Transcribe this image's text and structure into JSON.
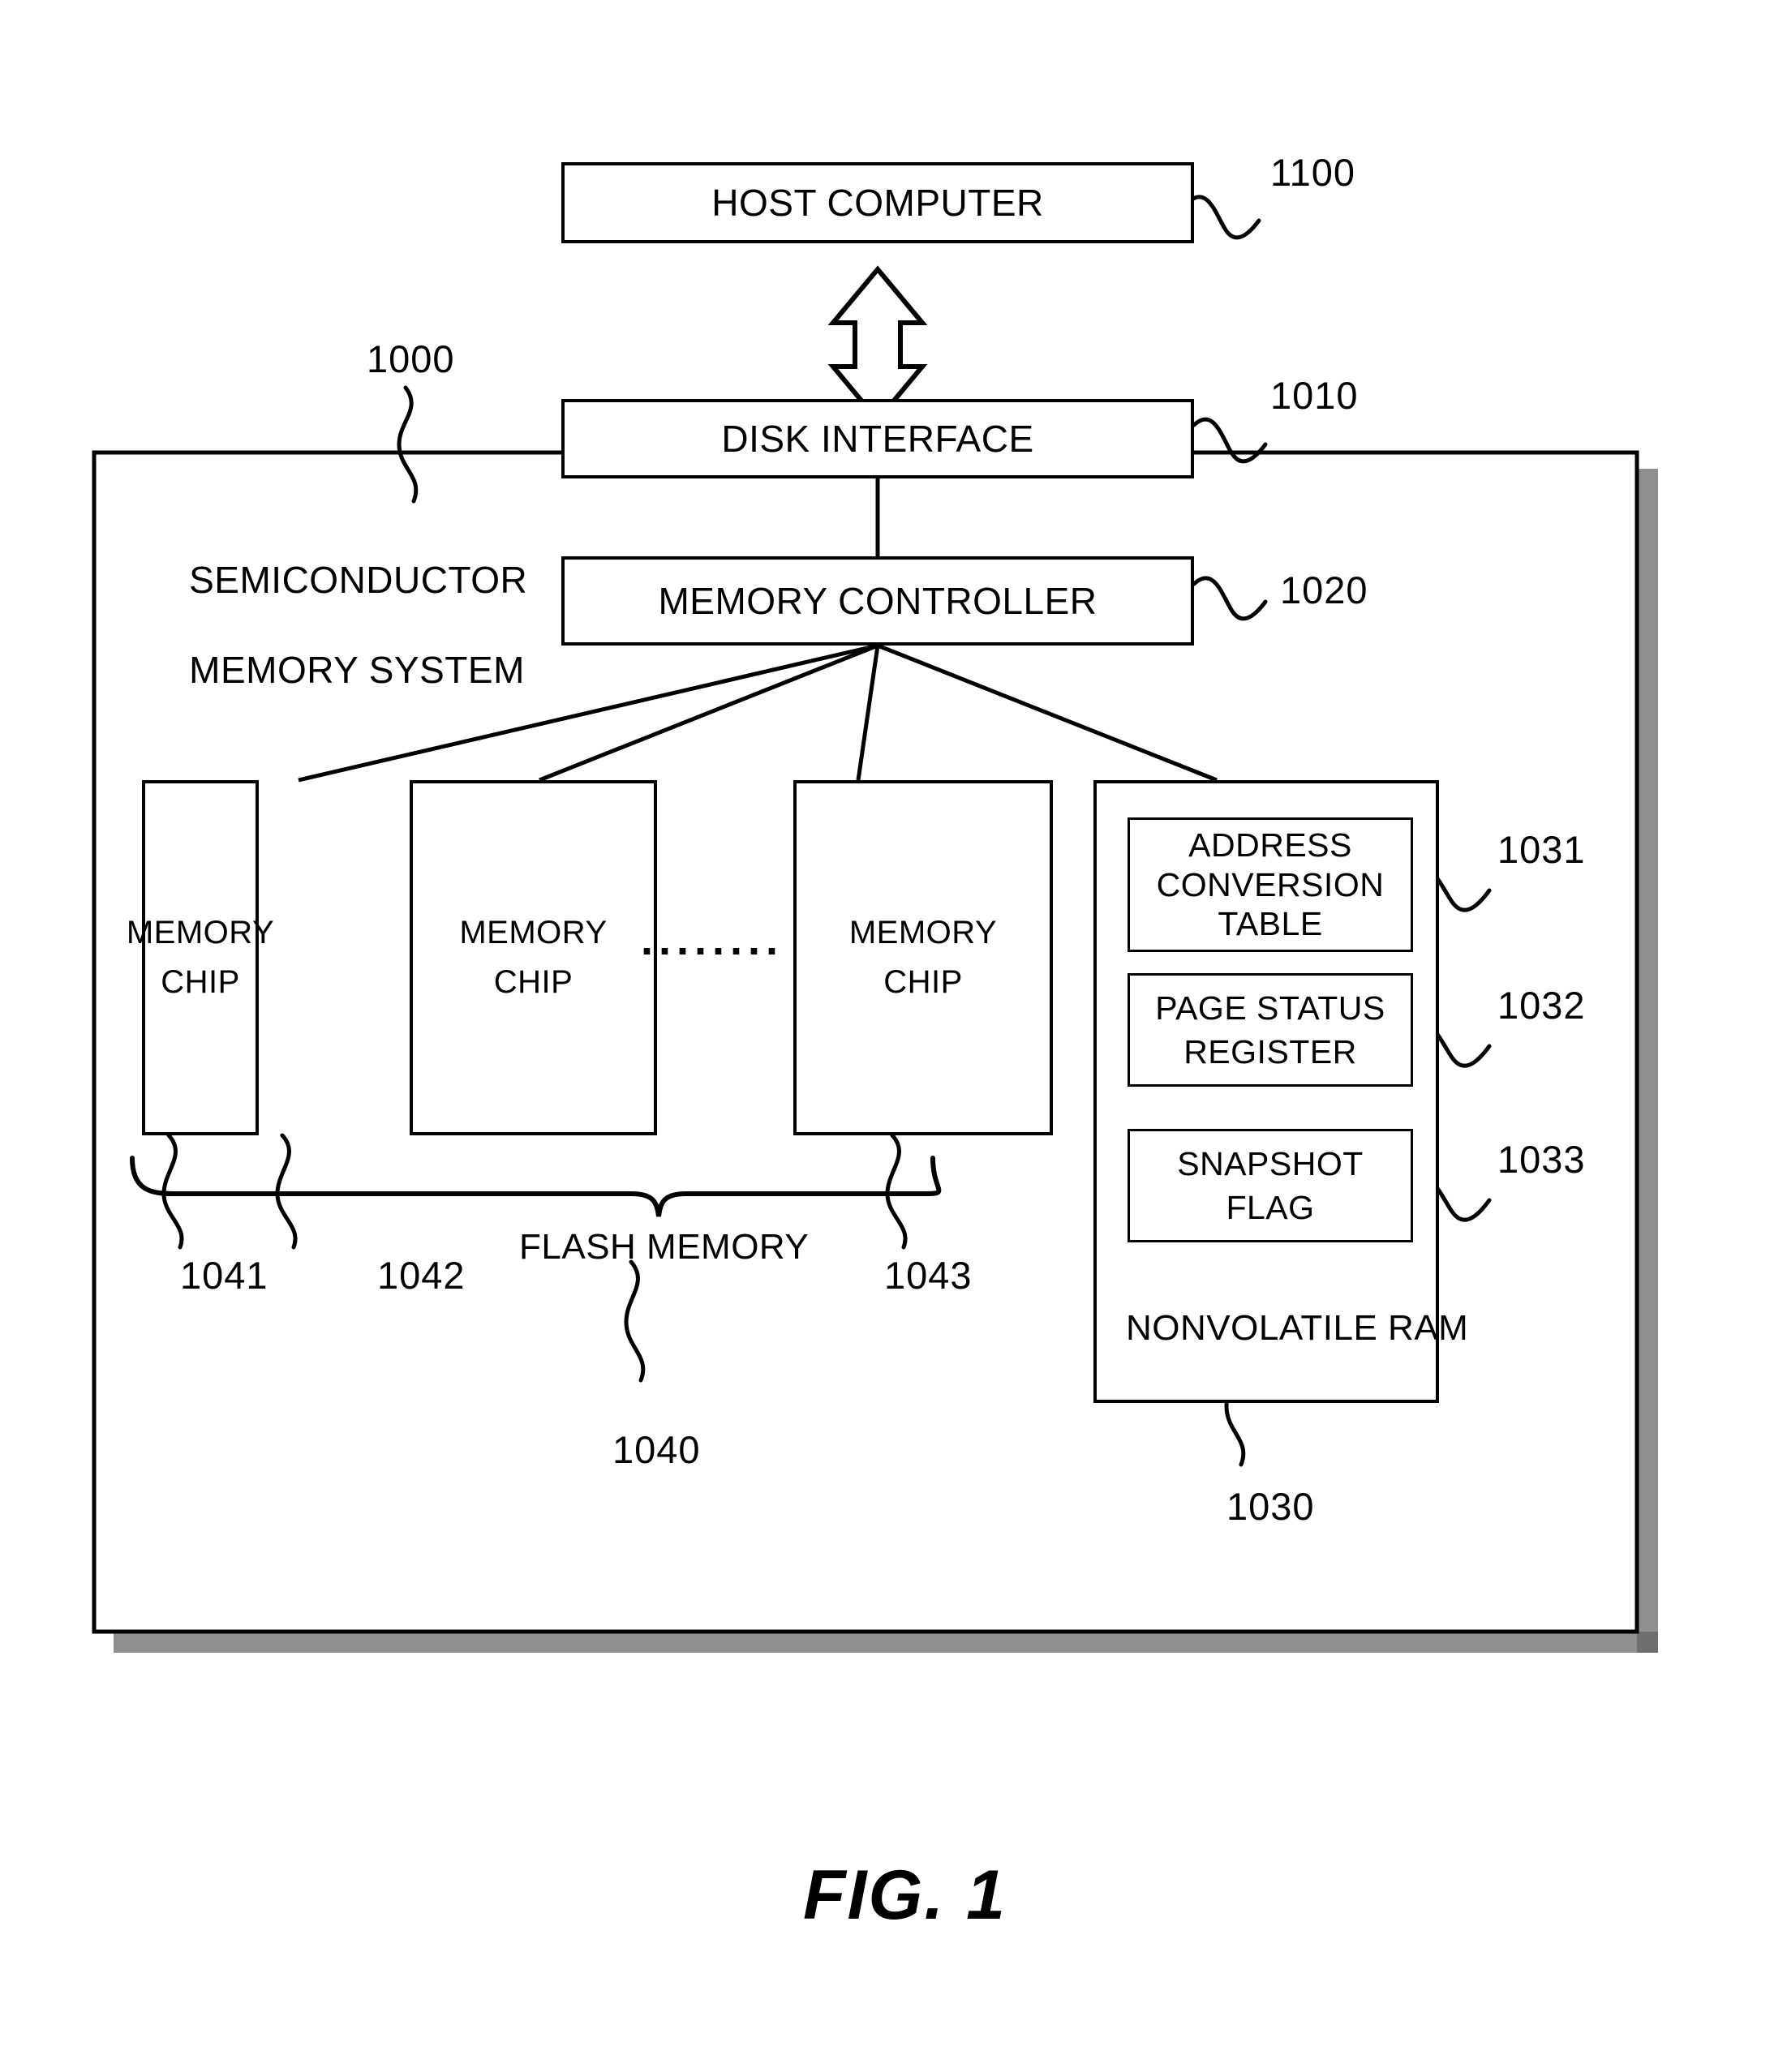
{
  "figure": {
    "caption": "FIG. 1",
    "system_label_line1": "SEMICONDUCTOR",
    "system_label_line2": "MEMORY SYSTEM"
  },
  "blocks": {
    "host_computer": {
      "label": "HOST COMPUTER",
      "ref": "1100"
    },
    "disk_interface": {
      "label": "DISK INTERFACE",
      "ref": "1010"
    },
    "memory_controller": {
      "label": "MEMORY CONTROLLER",
      "ref": "1020"
    },
    "semiconductor_memory_system": {
      "ref": "1000"
    },
    "memory_chip_1": {
      "label_line1": "MEMORY",
      "label_line2": "CHIP",
      "ref": "1041"
    },
    "memory_chip_2": {
      "label_line1": "MEMORY",
      "label_line2": "CHIP",
      "ref": "1042"
    },
    "memory_chip_3": {
      "label_line1": "MEMORY",
      "label_line2": "CHIP",
      "ref": "1043"
    },
    "memory_chip_ellipsis": "........",
    "flash_memory": {
      "label": "FLASH MEMORY",
      "ref": "1040"
    },
    "nonvolatile_ram": {
      "label": "NONVOLATILE RAM",
      "ref": "1030"
    },
    "address_conversion_table": {
      "label_line1": "ADDRESS",
      "label_line2": "CONVERSION",
      "label_line3": "TABLE",
      "ref": "1031"
    },
    "page_status_register": {
      "label_line1": "PAGE STATUS",
      "label_line2": "REGISTER",
      "ref": "1032"
    },
    "snapshot_flag": {
      "label_line1": "SNAPSHOT",
      "label_line2": "FLAG",
      "ref": "1033"
    }
  },
  "colors": {
    "ink": "#000000",
    "paper": "#ffffff",
    "shadow": "#9a9a9a"
  },
  "chart_data": {
    "type": "diagram",
    "title": "FIG. 1",
    "nodes": [
      {
        "id": "1100",
        "name": "HOST COMPUTER"
      },
      {
        "id": "1000",
        "name": "SEMICONDUCTOR MEMORY SYSTEM"
      },
      {
        "id": "1010",
        "name": "DISK INTERFACE"
      },
      {
        "id": "1020",
        "name": "MEMORY CONTROLLER"
      },
      {
        "id": "1040",
        "name": "FLASH MEMORY"
      },
      {
        "id": "1041",
        "name": "MEMORY CHIP"
      },
      {
        "id": "1042",
        "name": "MEMORY CHIP"
      },
      {
        "id": "1043",
        "name": "MEMORY CHIP"
      },
      {
        "id": "1030",
        "name": "NONVOLATILE RAM"
      },
      {
        "id": "1031",
        "name": "ADDRESS CONVERSION TABLE"
      },
      {
        "id": "1032",
        "name": "PAGE STATUS REGISTER"
      },
      {
        "id": "1033",
        "name": "SNAPSHOT FLAG"
      }
    ],
    "edges": [
      {
        "from": "1100",
        "to": "1010",
        "style": "double-arrow"
      },
      {
        "from": "1010",
        "to": "1020",
        "style": "line"
      },
      {
        "from": "1020",
        "to": "1041",
        "style": "line"
      },
      {
        "from": "1020",
        "to": "1042",
        "style": "line"
      },
      {
        "from": "1020",
        "to": "1043",
        "style": "line"
      },
      {
        "from": "1020",
        "to": "1030",
        "style": "line"
      }
    ],
    "containment": [
      {
        "parent": "1000",
        "children": [
          "1010",
          "1020",
          "1040",
          "1030"
        ]
      },
      {
        "parent": "1040",
        "children": [
          "1041",
          "1042",
          "1043"
        ]
      },
      {
        "parent": "1030",
        "children": [
          "1031",
          "1032",
          "1033"
        ]
      }
    ]
  }
}
